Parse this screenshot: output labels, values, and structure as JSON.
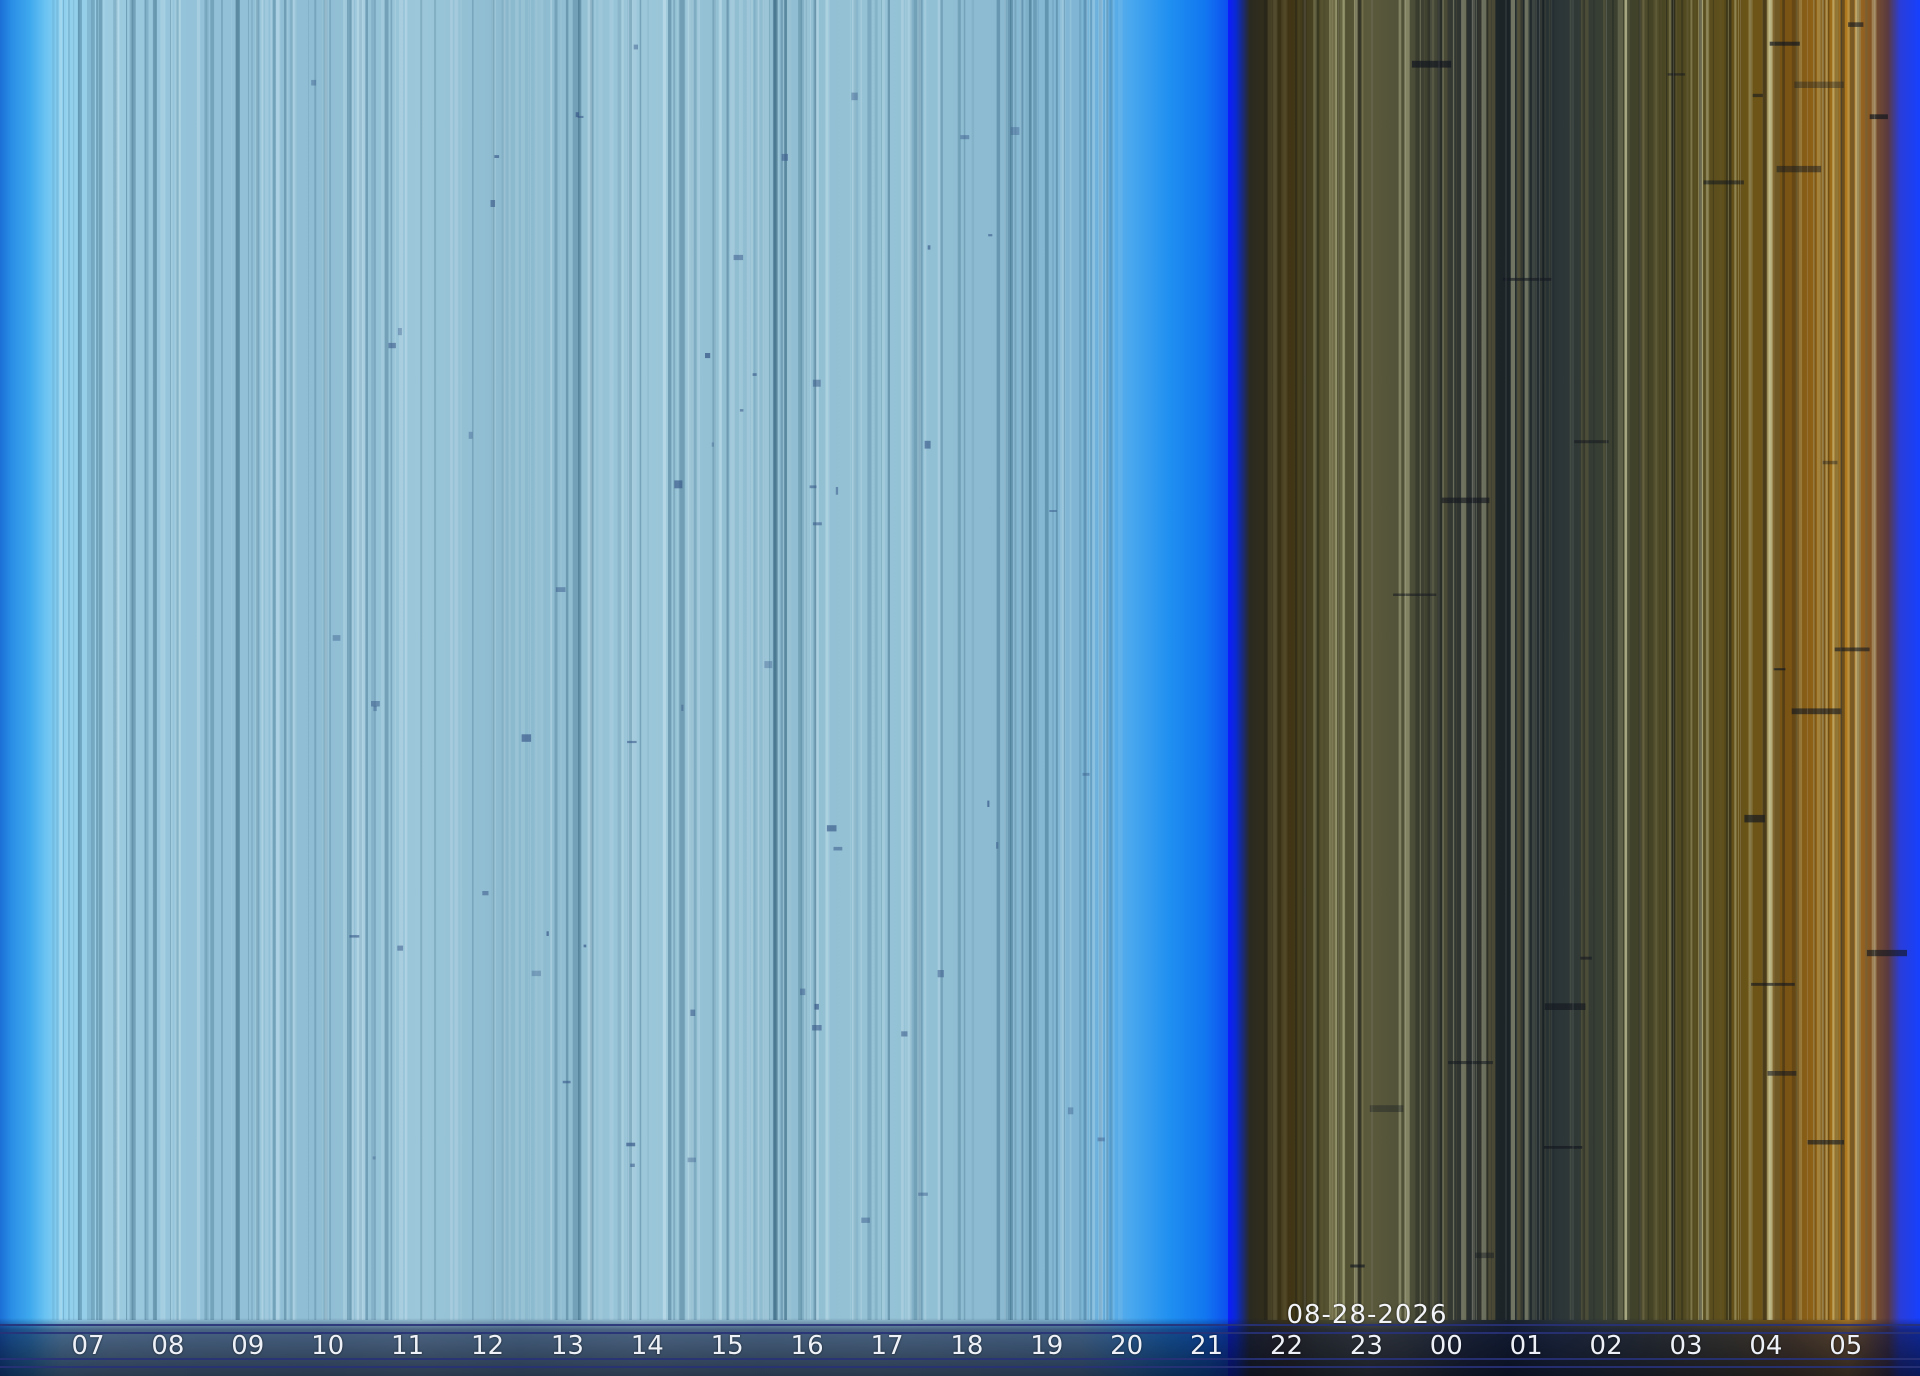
{
  "date": "08-28-2026",
  "hours": [
    "07",
    "08",
    "09",
    "10",
    "11",
    "12",
    "13",
    "14",
    "15",
    "16",
    "17",
    "18",
    "19",
    "20",
    "21",
    "22",
    "23",
    "00",
    "01",
    "02",
    "03",
    "04",
    "05"
  ],
  "colors": {
    "day": "#8fbfd4",
    "day_edge": "#1f8ff0",
    "night": "#3a3a28",
    "night_amber": "#b07a20",
    "night_edge": "#1640ff"
  }
}
